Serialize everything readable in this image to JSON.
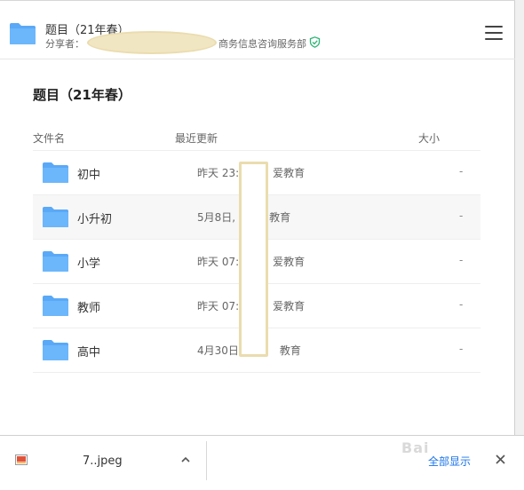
{
  "header": {
    "title": "题目（21年春）",
    "sharer_label": "分享者：",
    "sharer_suffix": "商务信息咨询服务部",
    "menu_icon": "hamburger-icon"
  },
  "main": {
    "title": "题目（21年春）",
    "columns": {
      "name": "文件名",
      "updated": "最近更新",
      "size": "大小"
    },
    "rows": [
      {
        "name": "初中",
        "updated": "昨天 23:",
        "updated_tail": "爱教育",
        "size": "-"
      },
      {
        "name": "小升初",
        "updated": "5月8日,",
        "updated_tail": "教育",
        "size": "-"
      },
      {
        "name": "小学",
        "updated": "昨天 07:",
        "updated_tail": "爱教育",
        "size": "-"
      },
      {
        "name": "教师",
        "updated": "昨天 07:",
        "updated_tail": "爱教育",
        "size": "-"
      },
      {
        "name": "高中",
        "updated": "4月30日",
        "updated_tail": "教育",
        "size": "-"
      }
    ]
  },
  "download_bar": {
    "file_name": "7..jpeg",
    "show_all": "全部显示"
  },
  "colors": {
    "folder": "#5aa9f7",
    "link": "#1a73e8",
    "verified": "#2bb673"
  }
}
